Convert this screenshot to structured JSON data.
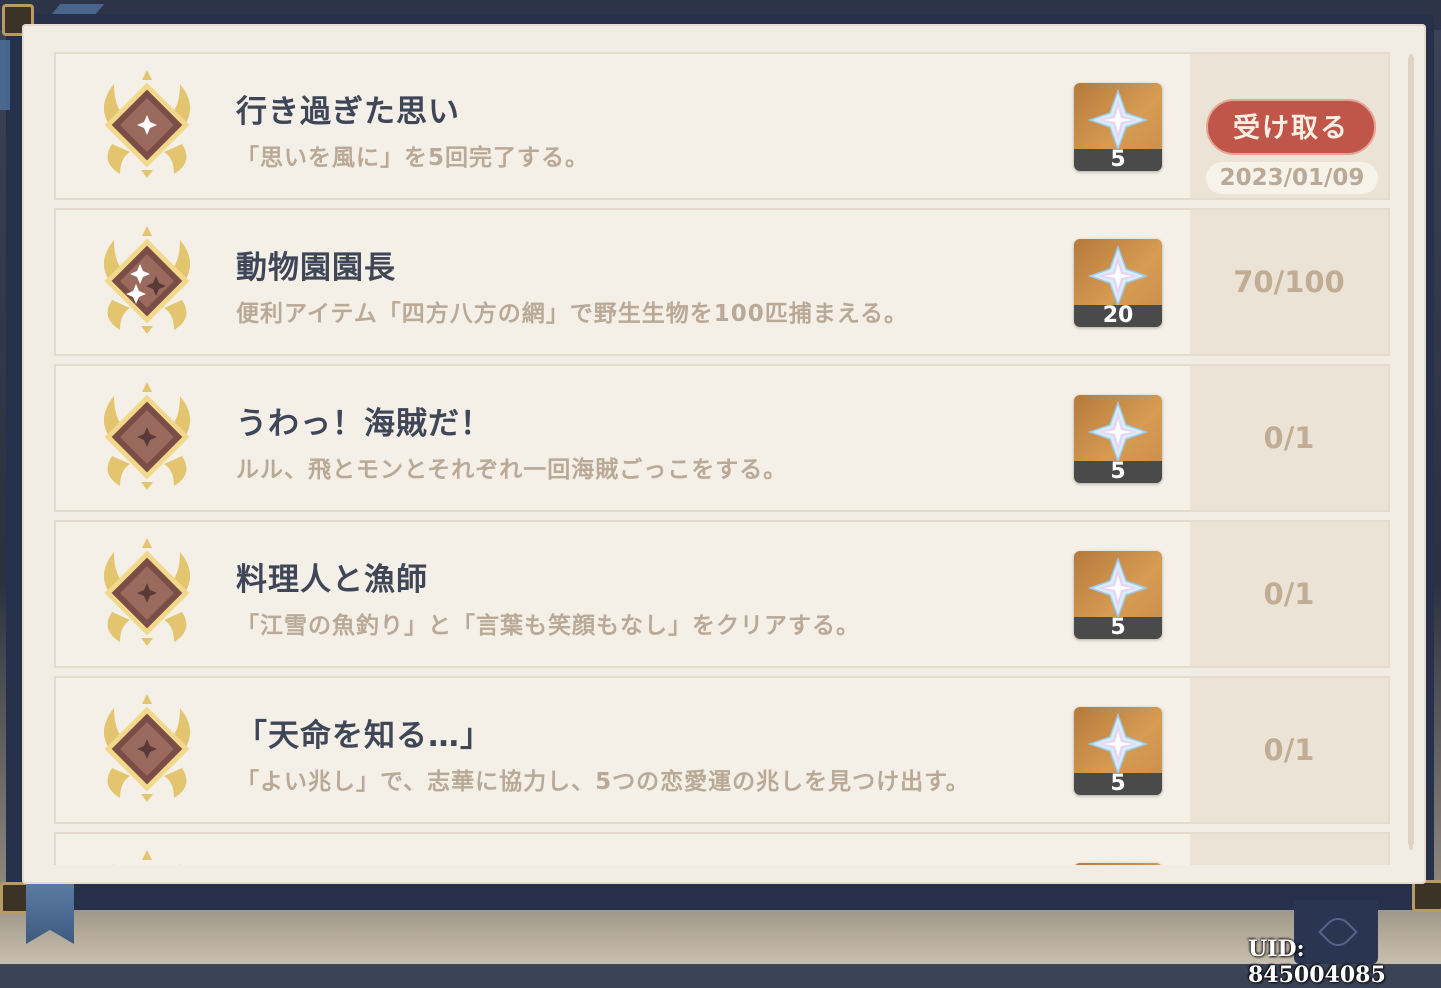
{
  "achievements": [
    {
      "title": "行き過ぎた思い",
      "description": "「思いを風に」を5回完了する。",
      "reward_count": "5",
      "status": "claimable",
      "claim_label": "受け取る",
      "claim_date": "2023/01/09",
      "badge_icon": "sparkle-single-icon"
    },
    {
      "title": "動物園園長",
      "description": "便利アイテム「四方八方の網」で野生生物を100匹捕まえる。",
      "reward_count": "20",
      "progress": "70/100",
      "badge_icon": "sparkle-triple-icon"
    },
    {
      "title": "うわっ！海賊だ！",
      "description": "ルル、飛とモンとそれぞれ一回海賊ごっこをする。",
      "reward_count": "5",
      "progress": "0/1",
      "badge_icon": "sparkle-single-icon"
    },
    {
      "title": "料理人と漁師",
      "description": "「江雪の魚釣り」と「言葉も笑顔もなし」をクリアする。",
      "reward_count": "5",
      "progress": "0/1",
      "badge_icon": "sparkle-single-icon"
    },
    {
      "title": "「天命を知る…」",
      "description": "「よい兆し」で、志華に協力し、5つの恋愛運の兆しを見つけ出す。",
      "reward_count": "5",
      "progress": "0/1",
      "badge_icon": "sparkle-single-icon"
    }
  ],
  "reward_icon": "primogem-icon",
  "uid_text": "UID: 845004085",
  "colors": {
    "claim_button": "#c0564a",
    "page_background": "#f2ede4",
    "title_text": "#3f4657",
    "description_text": "#b9a996",
    "badge_gold": "#e3c46f"
  }
}
